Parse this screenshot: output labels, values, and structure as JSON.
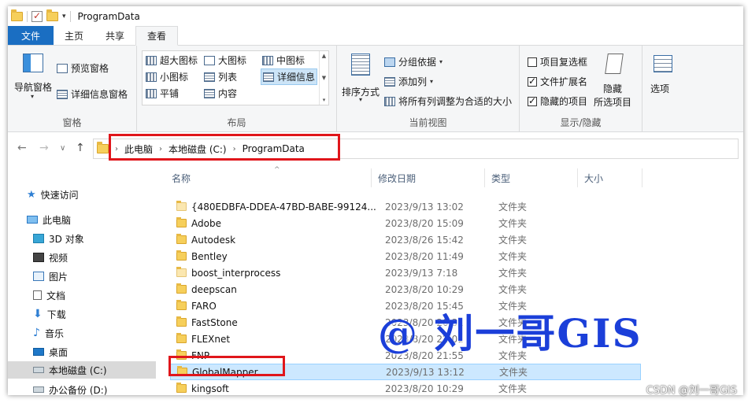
{
  "window": {
    "title": "ProgramData"
  },
  "tabs": [
    {
      "label": "文件"
    },
    {
      "label": "主页"
    },
    {
      "label": "共享"
    },
    {
      "label": "查看"
    }
  ],
  "ribbon": {
    "panes": {
      "nav_pane": "导航窗格",
      "preview_pane": "预览窗格",
      "details_pane": "详细信息窗格",
      "label": "窗格"
    },
    "layout": {
      "items": [
        "超大图标",
        "大图标",
        "中图标",
        "小图标",
        "列表",
        "详细信息",
        "平铺",
        "内容"
      ],
      "label": "布局"
    },
    "current_view": {
      "sort_by": "排序方式",
      "group_by": "分组依据",
      "add_columns": "添加列",
      "fit_columns": "将所有列调整为合适的大小",
      "label": "当前视图"
    },
    "show_hide": {
      "item_checkboxes": "项目复选框",
      "file_extensions": "文件扩展名",
      "hidden_items": "隐藏的项目",
      "hide_selected_1": "隐藏",
      "hide_selected_2": "所选项目",
      "label": "显示/隐藏"
    },
    "options": {
      "label": "选项"
    }
  },
  "address": {
    "crumbs": [
      "此电脑",
      "本地磁盘 (C:)",
      "ProgramData"
    ]
  },
  "sidebar": {
    "items": [
      {
        "label": "快速访问"
      },
      {
        "label": "此电脑"
      },
      {
        "label": "3D 对象"
      },
      {
        "label": "视频"
      },
      {
        "label": "图片"
      },
      {
        "label": "文档"
      },
      {
        "label": "下载"
      },
      {
        "label": "音乐"
      },
      {
        "label": "桌面"
      },
      {
        "label": "本地磁盘 (C:)"
      },
      {
        "label": "办公备份 (D:)"
      }
    ]
  },
  "columns": {
    "name": "名称",
    "date": "修改日期",
    "type": "类型",
    "size": "大小"
  },
  "files": [
    {
      "name": "{480EDBFA-DDEA-47BD-BABE-99124...",
      "date": "2023/9/13 13:02",
      "type": "文件夹"
    },
    {
      "name": "Adobe",
      "date": "2023/8/20 15:09",
      "type": "文件夹"
    },
    {
      "name": "Autodesk",
      "date": "2023/8/26 15:42",
      "type": "文件夹"
    },
    {
      "name": "Bentley",
      "date": "2023/8/20 11:49",
      "type": "文件夹"
    },
    {
      "name": "boost_interprocess",
      "date": "2023/9/13 7:18",
      "type": "文件夹"
    },
    {
      "name": "deepscan",
      "date": "2023/8/20 10:29",
      "type": "文件夹"
    },
    {
      "name": "FARO",
      "date": "2023/8/20 15:45",
      "type": "文件夹"
    },
    {
      "name": "FastStone",
      "date": "2023/8/20 20:31",
      "type": "文件夹"
    },
    {
      "name": "FLEXnet",
      "date": "2023/8/20 22:01",
      "type": "文件夹"
    },
    {
      "name": "FNP",
      "date": "2023/8/20 21:55",
      "type": "文件夹"
    },
    {
      "name": "GlobalMapper",
      "date": "2023/9/13 13:12",
      "type": "文件夹"
    },
    {
      "name": "kingsoft",
      "date": "2023/8/20 10:29",
      "type": "文件夹"
    }
  ],
  "watermark": "@ 刘一哥GIS",
  "csdn_mark": "CSDN @刘一哥GIS",
  "colors": {
    "accent": "#1a6ec2",
    "highlight": "#e0161b",
    "selection": "#cce8ff"
  }
}
